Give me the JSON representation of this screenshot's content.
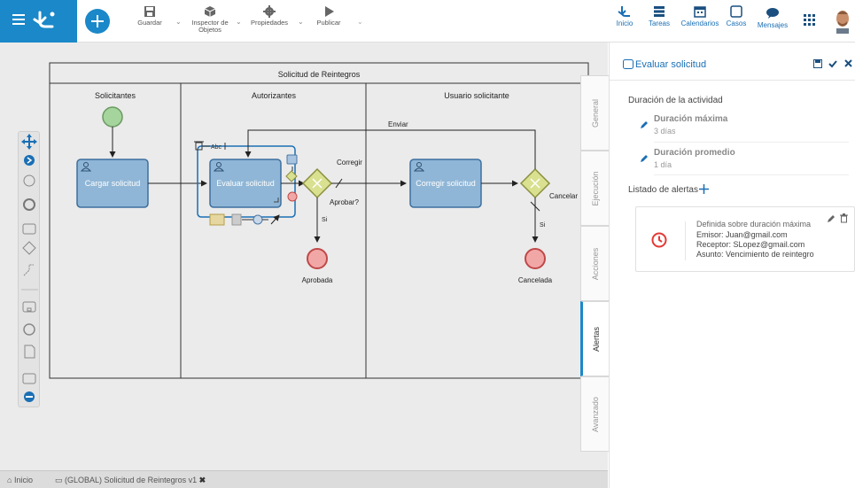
{
  "toolbar": {
    "save_label": "Guardar",
    "inspector_label_1": "Inspector de",
    "inspector_label_2": "Objetos",
    "properties_label": "Propiedades",
    "publish_label": "Publicar"
  },
  "nav": [
    {
      "label": "Inicio",
      "icon": "home-icon"
    },
    {
      "label": "Tareas",
      "icon": "tasks-icon"
    },
    {
      "label": "Calendarios",
      "icon": "calendar-icon"
    },
    {
      "label": "Casos",
      "icon": "cases-icon"
    },
    {
      "label": "Mensajes",
      "icon": "messages-icon"
    }
  ],
  "diagram": {
    "pool_title": "Solicitud de Reintegros",
    "lanes": [
      "Solicitantes",
      "Autorizantes",
      "Usuario solicitante"
    ],
    "tasks": {
      "cargar": "Cargar solicitud",
      "evaluar": "Evaluar solicitud",
      "corregir": "Corregir solicitud"
    },
    "labels": {
      "enviar": "Enviar",
      "corregir": "Corregir",
      "aprobar": "Aprobar?",
      "si1": "Si",
      "si2": "Si",
      "cancelar": "Cancelar",
      "aprobada": "Aprobada",
      "cancelada": "Cancelada",
      "abc": "Abc"
    }
  },
  "side_tabs": [
    "General",
    "Ejecución",
    "Acciones",
    "Alertas",
    "Avanzado"
  ],
  "active_tab": "Alertas",
  "panel": {
    "title": "Evaluar solicitud",
    "duration_section": "Duración de la actividad",
    "max_label": "Duración máxima",
    "max_value": "3 días",
    "avg_label": "Duración promedio",
    "avg_value": "1 día",
    "alerts_title": "Listado de alertas",
    "alert": {
      "line1": "Definida sobre duración máxima",
      "line2": "Emisor: Juan@gmail.com",
      "line3": "Receptor: SLopez@gmail.com",
      "line4": "Asunto: Vencimiento de reintegro"
    }
  },
  "footer": {
    "home": "Inicio",
    "tab": "(GLOBAL) Solicitud de Reintegros v1"
  },
  "colors": {
    "brand": "#1a88c9",
    "task_fill": "#8fb6d6",
    "task_stroke": "#3d6f9e",
    "start_event": "#a5d49c",
    "end_event": "#f2a7a7",
    "gateway": "#d9e08f"
  }
}
